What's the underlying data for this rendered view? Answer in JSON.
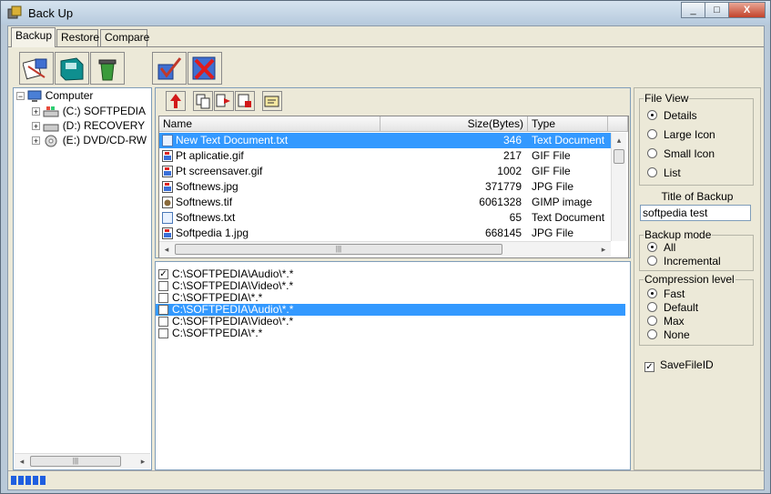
{
  "window": {
    "title": "Back Up",
    "controls": [
      "_",
      "□",
      "X"
    ]
  },
  "tabs": [
    {
      "label": "Backup"
    },
    {
      "label": "Restore"
    },
    {
      "label": "Compare"
    }
  ],
  "toolbar": {
    "buttons": [
      "backup-wizard-icon",
      "save-backup-icon",
      "trash-icon",
      "check-icon",
      "cancel-icon"
    ]
  },
  "tree": {
    "root": "Computer",
    "drives": [
      {
        "label": "(C:)  SOFTPEDIA"
      },
      {
        "label": "(D:)  RECOVERY"
      },
      {
        "label": "(E:)  DVD/CD-RW"
      }
    ]
  },
  "file_list": {
    "columns": [
      "Name",
      "Size(Bytes)",
      "Type"
    ],
    "rows": [
      {
        "name": "New Text Document.txt",
        "size": "346",
        "type": "Text Document",
        "selected": true
      },
      {
        "name": "Pt aplicatie.gif",
        "size": "217",
        "type": "GIF File"
      },
      {
        "name": "Pt screensaver.gif",
        "size": "1002",
        "type": "GIF File"
      },
      {
        "name": "Softnews.jpg",
        "size": "371779",
        "type": "JPG File"
      },
      {
        "name": "Softnews.tif",
        "size": "6061328",
        "type": "GIMP image"
      },
      {
        "name": "Softnews.txt",
        "size": "65",
        "type": "Text Document"
      },
      {
        "name": "Softpedia 1.jpg",
        "size": "668145",
        "type": "JPG File"
      }
    ]
  },
  "backup_list": [
    {
      "path": "C:\\SOFTPEDIA\\Audio\\*.*",
      "checked": true
    },
    {
      "path": "C:\\SOFTPEDIA\\Video\\*.*",
      "checked": false
    },
    {
      "path": "C:\\SOFTPEDIA\\*.*",
      "checked": false
    },
    {
      "path": "C:\\SOFTPEDIA\\Audio\\*.*",
      "checked": false,
      "selected": true
    },
    {
      "path": "C:\\SOFTPEDIA\\Video\\*.*",
      "checked": false
    },
    {
      "path": "C:\\SOFTPEDIA\\*.*",
      "checked": false
    }
  ],
  "settings": {
    "file_view": {
      "label": "File View",
      "options": [
        "Details",
        "Large Icon",
        "Small Icon",
        "List"
      ],
      "selected": "Details"
    },
    "title_label": "Title of Backup",
    "title_value": "softpedia test",
    "backup_mode": {
      "label": "Backup mode",
      "options": [
        "All",
        "Incremental"
      ],
      "selected": "All"
    },
    "compression": {
      "label": "Compression level",
      "options": [
        "Fast",
        "Default",
        "Max",
        "None"
      ],
      "selected": "Fast"
    },
    "save_file_id": {
      "label": "SaveFileID",
      "checked": true
    }
  },
  "status": {
    "progress_blocks": 5
  },
  "colors": {
    "selection": "#3399ff",
    "panel_bg": "#ece9d8",
    "progress": "#1f5fe0"
  }
}
